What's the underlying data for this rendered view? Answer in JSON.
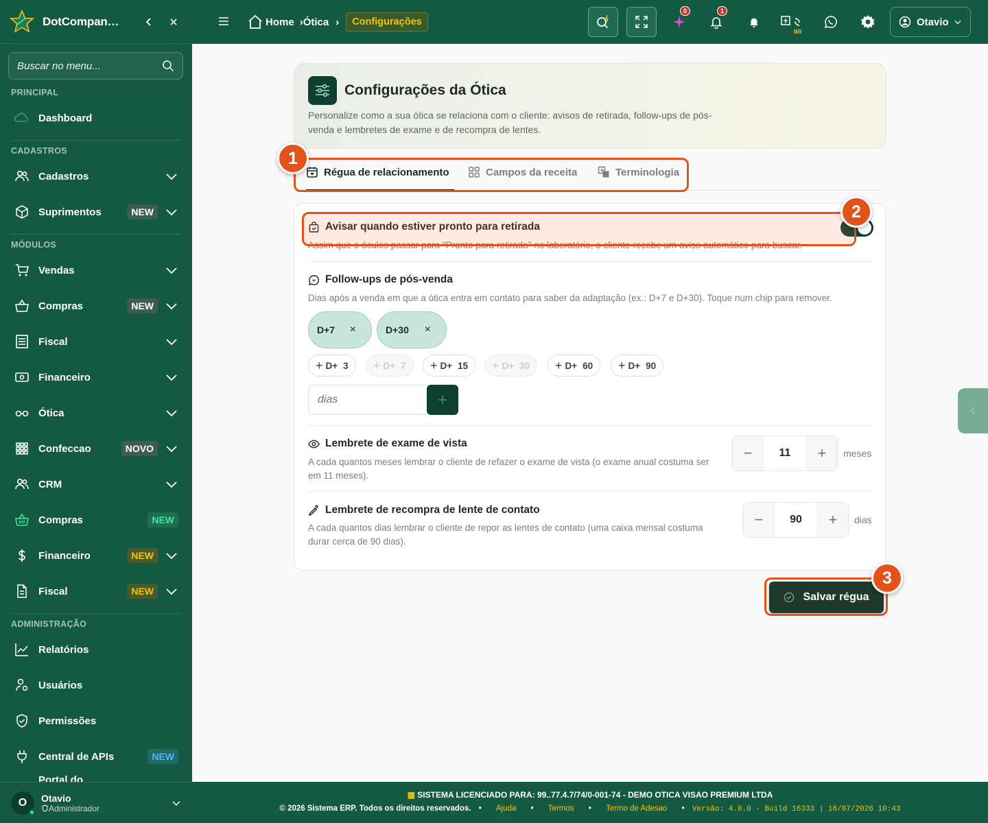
{
  "app": {
    "brand": "DotCompan…"
  },
  "sidebar": {
    "search_placeholder": "Buscar no menu...",
    "sections": {
      "principal": "PRINCIPAL",
      "cadastros": "CADASTROS",
      "modulos": "MÓDULOS",
      "administracao": "ADMINISTRAÇÃO"
    },
    "items": {
      "dashboard": {
        "label": "Dashboard",
        "icon": "cloud-icon"
      },
      "cadastros": {
        "label": "Cadastros",
        "icon": "users-icon"
      },
      "suprimentos": {
        "label": "Suprimentos",
        "badge": "NEW",
        "icon": "box-icon"
      },
      "vendas": {
        "label": "Vendas",
        "icon": "cart-icon"
      },
      "compras": {
        "label": "Compras",
        "badge": "NEW",
        "icon": "basket-icon"
      },
      "fiscal": {
        "label": "Fiscal",
        "icon": "receipt-icon"
      },
      "financeiro": {
        "label": "Financeiro",
        "icon": "cash-icon"
      },
      "otica": {
        "label": "Ótica",
        "icon": "glasses-icon"
      },
      "confeccao": {
        "label": "Confeccao",
        "badge": "NOVO",
        "icon": "grid-icon"
      },
      "crm": {
        "label": "CRM",
        "icon": "users-icon"
      },
      "compras2": {
        "label": "Compras",
        "badge": "NEW",
        "icon": "basket-icon"
      },
      "financeiro2": {
        "label": "Financeiro",
        "badge": "NEW",
        "icon": "dollar-icon"
      },
      "fiscal2": {
        "label": "Fiscal",
        "badge": "NEW",
        "icon": "document-icon"
      },
      "relatorios": {
        "label": "Relatórios",
        "icon": "chart-icon"
      },
      "usuarios": {
        "label": "Usuários",
        "icon": "user-gear-icon"
      },
      "permissoes": {
        "label": "Permissões",
        "icon": "shield-icon"
      },
      "central_apis": {
        "label": "Central de APIs",
        "badge": "NEW",
        "icon": "plug-icon"
      },
      "portal": {
        "label": "Portal do"
      }
    },
    "user": {
      "initial": "O",
      "name": "Otavio",
      "role": "Administrador"
    }
  },
  "topbar": {
    "breadcrumb": {
      "home": "Home",
      "otica": "Ótica",
      "current": "Configurações"
    },
    "badges": {
      "sparkle": "0",
      "bell": "1"
    },
    "lang": "BR",
    "user": "Otavio"
  },
  "page": {
    "title": "Configurações da Ótica",
    "description": "Personalize como a sua ótica se relaciona com o cliente: avisos de retirada, follow-ups de pós-venda e lembretes de exame e de recompra de lentes.",
    "tabs": [
      "Régua de relacionamento",
      "Campos da receita",
      "Terminologia"
    ],
    "pickup": {
      "title": "Avisar quando estiver pronto para retirada",
      "description": "Assim que o óculos passar para \"Pronto para retirada\" no laboratório, o cliente recebe um aviso automático para buscar."
    },
    "followups": {
      "title": "Follow-ups de pós-venda",
      "description": "Dias após a venda em que a ótica entra em contato para saber da adaptação (ex.: D+7 e D+30). Toque num chip para remover.",
      "selected": [
        "D+7",
        "D+30"
      ],
      "remove_symbol": "×",
      "prefix": "D+",
      "options": [
        "3",
        "7",
        "15",
        "30",
        "60",
        "90"
      ],
      "days_placeholder": "dias"
    },
    "exam": {
      "title": "Lembrete de exame de vista",
      "description": "A cada quantos meses lembrar o cliente de refazer o exame de vista (o exame anual costuma ser em 11 meses).",
      "value": "11",
      "unit": "meses"
    },
    "lens": {
      "title": "Lembrete de recompra de lente de contato",
      "description": "A cada quantos dias lembrar o cliente de repor as lentes de contato (uma caixa mensal costuma durar cerca de 90 dias).",
      "value": "90",
      "unit": "dias"
    },
    "save_label": "Salvar régua",
    "minus": "−",
    "plus": "+"
  },
  "annotations": [
    "1",
    "2",
    "3"
  ],
  "footer": {
    "license_label": "SISTEMA LICENCIADO PARA:",
    "license_value": "99..77.4.7/74/0-001-74 - DEMO OTICA VISAO PREMIUM LTDA",
    "copyright": "© 2026 Sistema ERP. Todos os direitos reservados.",
    "links": [
      "Ajuda",
      "Termos",
      "Termo de Adesao"
    ],
    "version": "Versão: 4.0.0 - Build 16333 | 18/07/2026 10:43"
  },
  "colors": {
    "primary": "#145a42",
    "accent_gold": "#f1c40f",
    "highlight": "#e4521c"
  }
}
